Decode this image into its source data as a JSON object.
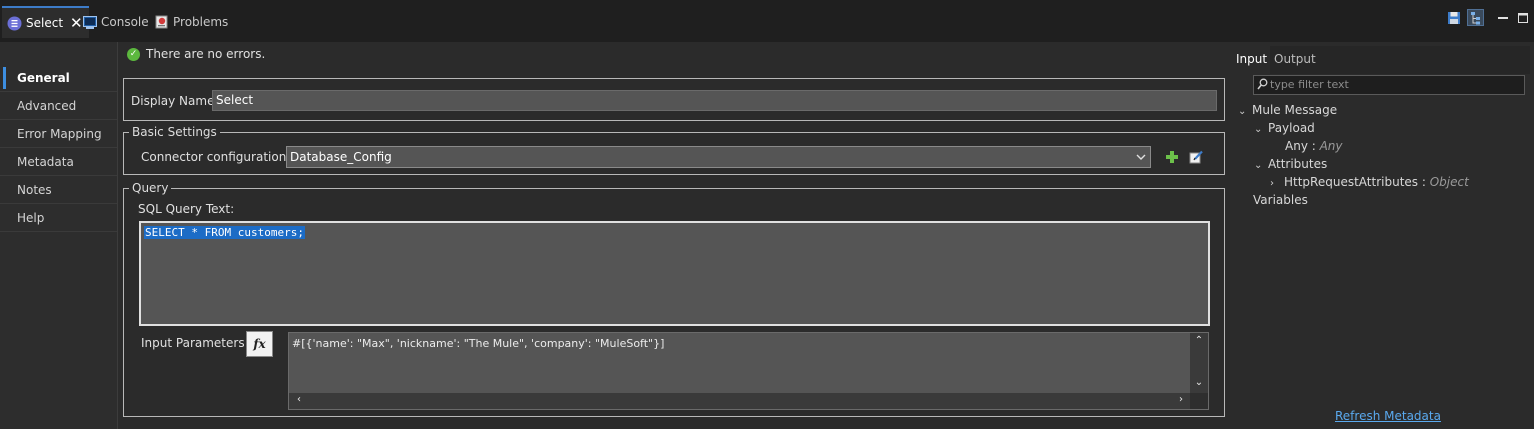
{
  "tabs": [
    {
      "label": "Select",
      "icon": "db-operation-icon",
      "active": true
    },
    {
      "label": "Console",
      "icon": "console-icon",
      "active": false
    },
    {
      "label": "Problems",
      "icon": "problems-icon",
      "active": false
    }
  ],
  "window_controls": {
    "save": "save-icon",
    "tree": "tree-view-icon",
    "minimize": "minimize-icon",
    "maximize": "maximize-icon"
  },
  "nav": {
    "items": [
      "General",
      "Advanced",
      "Error Mapping",
      "Metadata",
      "Notes",
      "Help"
    ],
    "active": "General"
  },
  "status": {
    "message": "There are no errors."
  },
  "general": {
    "display_name_label": "Display Name:",
    "display_name_value": "Select",
    "basic_settings_title": "Basic Settings",
    "connector_label": "Connector configuration:",
    "connector_value": "Database_Config",
    "query_title": "Query",
    "sql_label": "SQL Query Text:",
    "sql_value": "SELECT * FROM customers;",
    "params_label": "Input Parameters:",
    "fx_label": "fx",
    "params_value": "#[{'name': \"Max\", 'nickname': \"The Mule\", 'company': \"MuleSoft\"}]"
  },
  "metadata_panel": {
    "tabs": [
      "Input",
      "Output"
    ],
    "active_tab": "Input",
    "filter_placeholder": "type filter text",
    "tree": {
      "mule_message": "Mule Message",
      "payload": "Payload",
      "any_name": "Any",
      "any_sep": " : ",
      "any_type": "Any",
      "attributes": "Attributes",
      "http_attr": "HttpRequestAttributes",
      "http_sep": " : ",
      "http_type": "Object",
      "variables": "Variables"
    },
    "refresh_label": "Refresh Metadata"
  },
  "colors": {
    "accent": "#3d8ee0",
    "ok": "#5cb83e",
    "selection": "#1c6cc6",
    "link": "#5aa9ee"
  }
}
